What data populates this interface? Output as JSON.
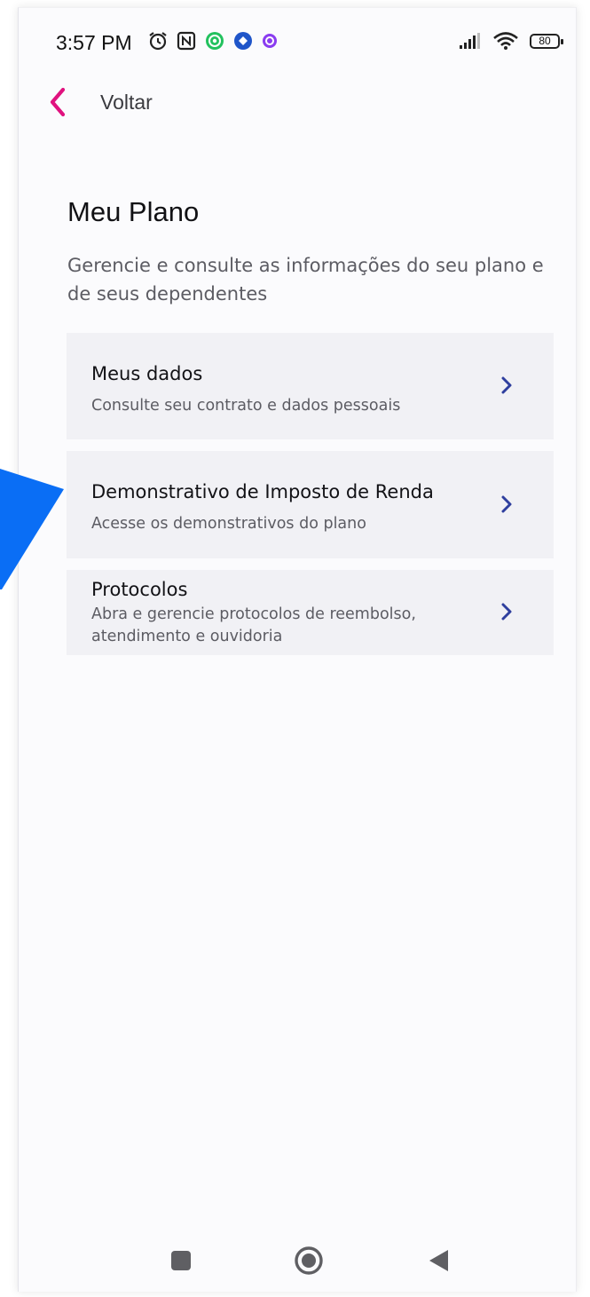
{
  "status_bar": {
    "time": "3:57 PM",
    "battery": "80",
    "icons_left": [
      "alarm-icon",
      "nfc-icon",
      "whatsapp-icon",
      "app-icon",
      "messenger-icon"
    ],
    "icons_right": [
      "signal-icon",
      "wifi-icon",
      "battery-icon"
    ]
  },
  "header": {
    "back_label": "Voltar"
  },
  "page": {
    "title": "Meu Plano",
    "subtitle": "Gerencie e consulte as informações do seu plano e de seus dependentes"
  },
  "menu": {
    "items": [
      {
        "title": "Meus dados",
        "description": "Consulte seu contrato e dados pessoais"
      },
      {
        "title": "Demonstrativo de Imposto de Renda",
        "description": "Acesse os demonstrativos do plano"
      },
      {
        "title": "Protocolos",
        "description": "Abra e gerencie protocolos de reembolso, atendimento e ouvidoria"
      }
    ]
  },
  "colors": {
    "accent": "#e0127f",
    "chevron": "#2f3f9e",
    "card_bg": "#f1f1f5",
    "pointer": "#0a6ef5"
  },
  "nav_bar": {
    "buttons": [
      "recents-icon",
      "home-icon",
      "back-icon"
    ]
  }
}
